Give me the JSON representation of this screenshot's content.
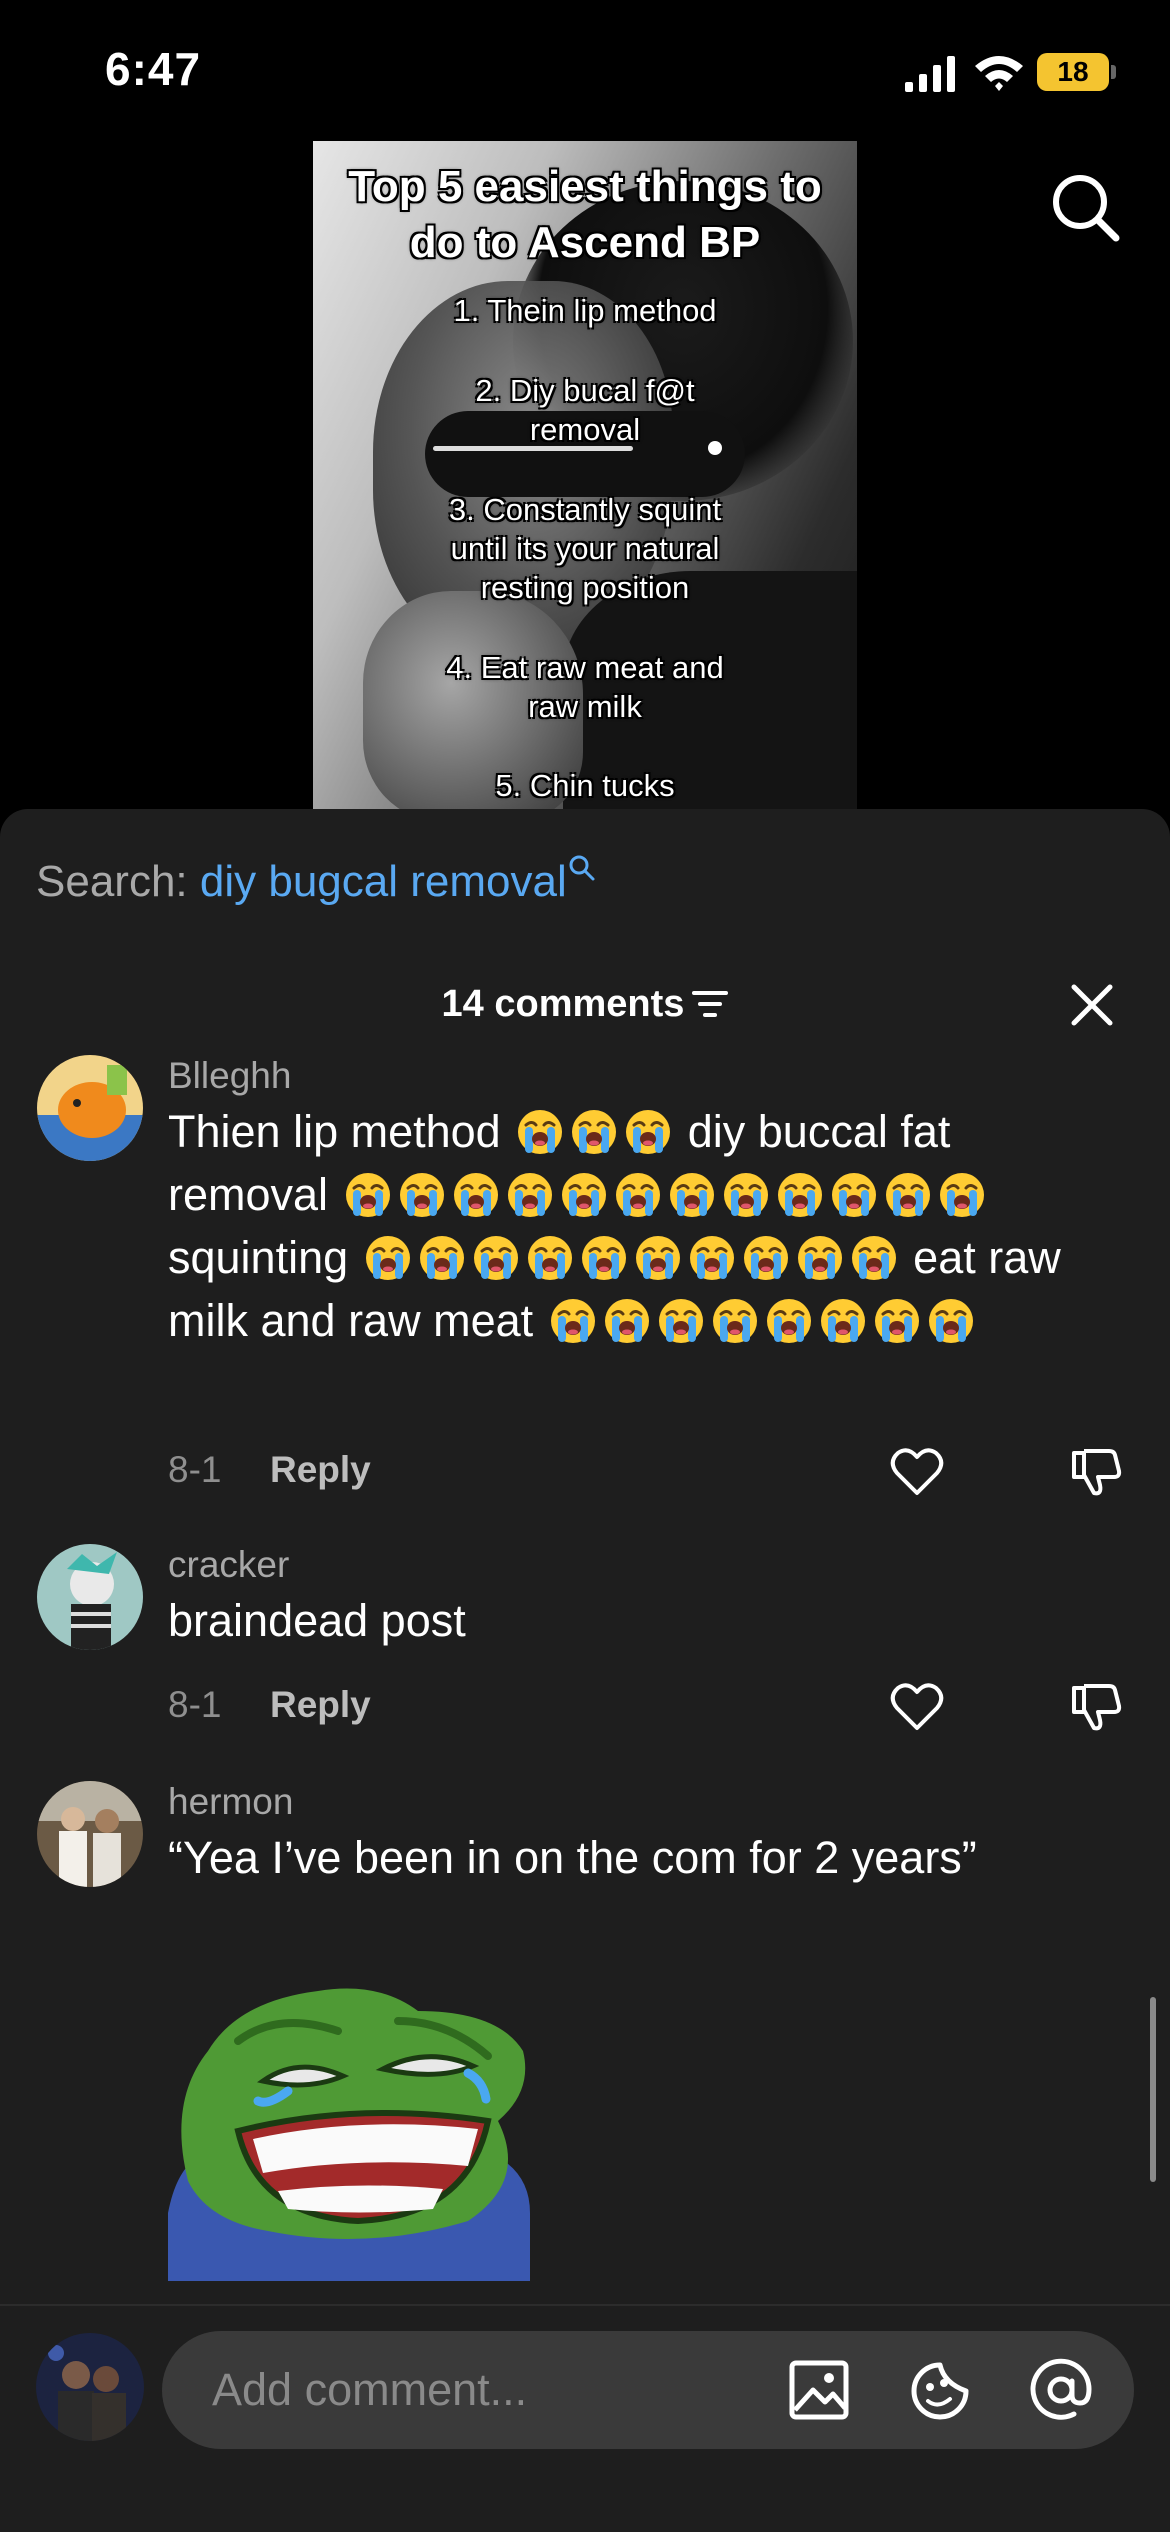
{
  "status": {
    "time": "6:47",
    "battery": "18"
  },
  "video": {
    "title": "Top 5 easiest things to do to Ascend BP",
    "items": [
      "1. Thein lip method",
      "2. Diy bucal f@t removal",
      "3. Constantly squint until its your natural resting position",
      "4. Eat raw meat and raw milk",
      "5. Chin tucks"
    ]
  },
  "search": {
    "prefix": "Search: ",
    "term": "diy bugcal removal"
  },
  "comments_header": {
    "count_label": "14 comments"
  },
  "comments": [
    {
      "user": "Blleghh",
      "segments": [
        "Thien lip method",
        "diy buccal fat removal",
        "squinting",
        "eat raw milk and raw meat"
      ],
      "emoji_counts": [
        3,
        12,
        10,
        8
      ],
      "date": "8-1",
      "reply_label": "Reply"
    },
    {
      "user": "cracker",
      "text": "braindead post",
      "date": "8-1",
      "reply_label": "Reply"
    },
    {
      "user": "hermon",
      "text": "“Yea I’ve been in on the com for 2 years”"
    }
  ],
  "input": {
    "placeholder": "Add comment..."
  },
  "colors": {
    "sheet_bg": "#1e1e1e",
    "search_term": "#5aa9f2",
    "battery": "#f4c430",
    "field_bg": "#3a3a3a"
  },
  "icons": [
    "search-icon",
    "filter-icon",
    "close-icon",
    "heart-icon",
    "dislike-icon",
    "image-icon",
    "sticker-icon",
    "mention-icon",
    "crying-emoji"
  ]
}
